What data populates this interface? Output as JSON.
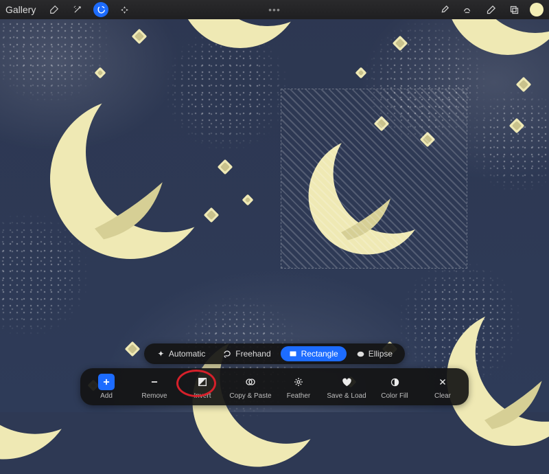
{
  "topbar": {
    "gallery": "Gallery"
  },
  "selection_modes": {
    "automatic": "Automatic",
    "freehand": "Freehand",
    "rectangle": "Rectangle",
    "ellipse": "Ellipse"
  },
  "tools": {
    "add": "Add",
    "remove": "Remove",
    "invert": "Invert",
    "copy_paste": "Copy & Paste",
    "feather": "Feather",
    "save_load": "Save & Load",
    "color_fill": "Color Fill",
    "clear": "Clear"
  },
  "highlight": "invert",
  "colors": {
    "accent": "#1d6cff",
    "swatch": "#f3eeb5",
    "highlight_ring": "#d6202a"
  }
}
